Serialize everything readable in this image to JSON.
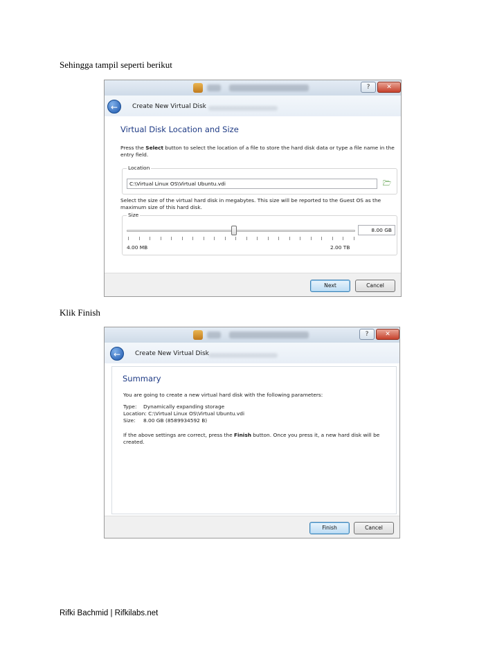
{
  "document": {
    "text_1": "Sehingga tampil seperti berikut",
    "text_2": "Klik Finish",
    "footer": "Rifki Bachmid | Rifkilabs.net"
  },
  "window_buttons": {
    "help": "?",
    "close": "✕"
  },
  "dialog1": {
    "title": "Create New Virtual Disk",
    "heading": "Virtual Disk Location and Size",
    "intro_before": "Press the ",
    "intro_bold": "Select",
    "intro_after": " button to select the location of a file to store the hard disk data or type a file name in the entry field.",
    "location_group_label": "Location",
    "location_value": "C:\\Virtual Linux OS\\Virtual Ubuntu.vdi",
    "size_text": "Select the size of the virtual hard disk in megabytes. This size will be reported to the Guest OS as the maximum size of this hard disk.",
    "size_group_label": "Size",
    "size_value": "8.00 GB",
    "slider_level_fraction": 0.47,
    "slider_min_label": "4.00 MB",
    "slider_max_label": "2.00 TB",
    "next_button": "Next",
    "cancel_button": "Cancel"
  },
  "dialog2": {
    "title": "Create New Virtual Disk",
    "heading": "Summary",
    "intro": "You are going to create a new virtual hard disk with the following parameters:",
    "params": [
      {
        "key": "Type:",
        "value": "Dynamically expanding storage"
      },
      {
        "key": "Location:",
        "value": "C:\\Virtual Linux OS\\Virtual Ubuntu.vdi"
      },
      {
        "key": "Size:",
        "value": "8.00 GB (8589934592 B)"
      }
    ],
    "confirm_before": "If the above settings are correct, press the ",
    "confirm_bold": "Finish",
    "confirm_after": " button. Once you press it, a new hard disk will be created.",
    "finish_button": "Finish",
    "cancel_button": "Cancel"
  },
  "colors": {
    "heading": "#1e3a84",
    "primary_button_border": "#3c7fb1",
    "close_button": "#c6412c"
  }
}
